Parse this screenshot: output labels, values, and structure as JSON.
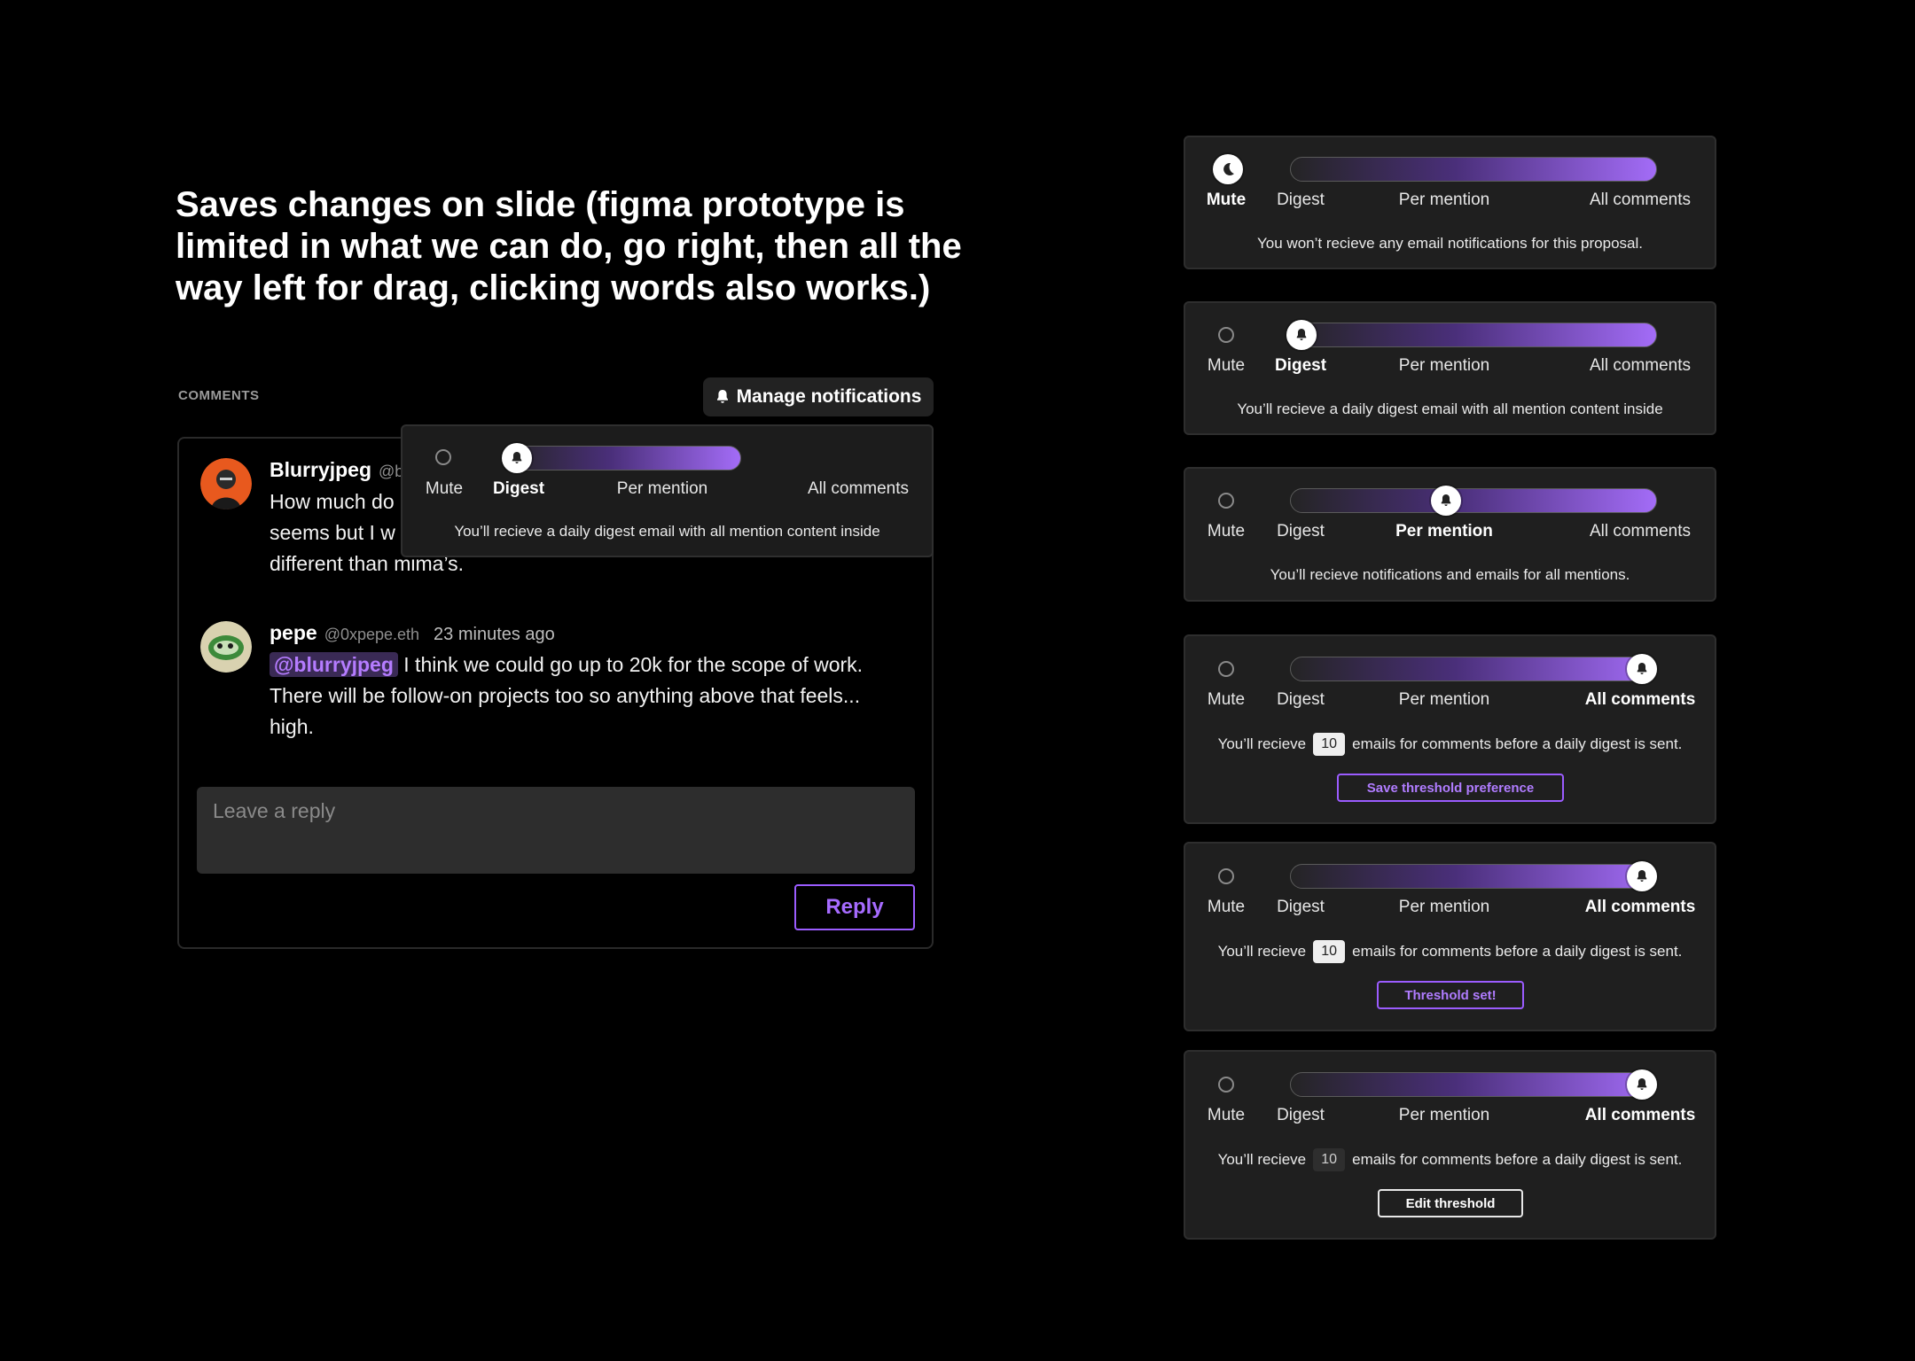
{
  "headline": "Saves changes on slide (figma prototype is limited in what we can do, go right, then all the way left for drag, clicking words also works.)",
  "comments_label": "COMMENTS",
  "manage_notifications": "Manage notifications",
  "levels": [
    "Mute",
    "Digest",
    "Per mention",
    "All comments"
  ],
  "comments": [
    {
      "name": "Blurryjpeg",
      "handle": "@b",
      "body_lines": [
        "How much do",
        "seems but I w",
        "different than mima’s."
      ]
    },
    {
      "name": "pepe",
      "handle": "@0xpepe.eth",
      "time": "23 minutes ago",
      "mention": "@blurryjpeg",
      "body": "I think we could go up to 20k for the scope of work. There will be follow-on projects too so anything above that feels... high."
    }
  ],
  "reply_placeholder": "Leave a reply",
  "reply_button": "Reply",
  "popover": {
    "selected": "Digest",
    "description": "You’ll recieve a daily digest email with all mention content inside"
  },
  "panels": [
    {
      "selected": "Mute",
      "description": "You won’t recieve any email notifications for this proposal."
    },
    {
      "selected": "Digest",
      "description": "You’ll recieve a daily digest email with all mention content inside"
    },
    {
      "selected": "Per mention",
      "description": "You’ll recieve notifications and emails for all mentions."
    },
    {
      "selected": "All comments",
      "threshold_prefix": "You’ll recieve",
      "threshold_value": "10",
      "threshold_suffix": "emails for comments before a daily digest is sent.",
      "button": "Save threshold preference"
    },
    {
      "selected": "All comments",
      "threshold_prefix": "You’ll recieve",
      "threshold_value": "10",
      "threshold_suffix": "emails for comments before a daily digest is sent.",
      "button": "Threshold set!"
    },
    {
      "selected": "All comments",
      "threshold_prefix": "You’ll recieve",
      "threshold_value": "10",
      "threshold_suffix": "emails for comments before a daily digest is sent.",
      "button": "Edit threshold"
    }
  ],
  "colors": {
    "accent": "#9b5cff",
    "panel_bg": "#1f1f1f",
    "mention_bg": "#3a2a55"
  }
}
